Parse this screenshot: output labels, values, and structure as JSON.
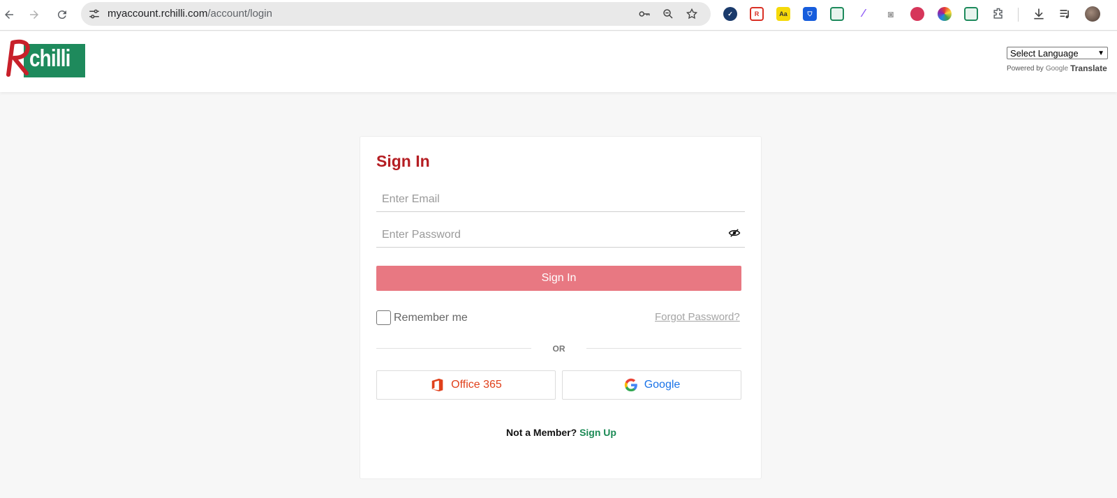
{
  "browser": {
    "url_host": "myaccount.rchilli.com",
    "url_path": "/account/login",
    "extensions": [
      {
        "icon": "check-circle-icon",
        "color": "#1a3a6b"
      },
      {
        "icon": "r-icon",
        "color": "#d93025"
      },
      {
        "icon": "dictionary-icon",
        "color": "#f5d90a",
        "text": "Aa"
      },
      {
        "icon": "bitwarden-icon",
        "color": "#175ddc"
      },
      {
        "icon": "screenshot-icon",
        "color": "#1e8a5c"
      },
      {
        "icon": "pen-icon",
        "color": "#8f5cf5"
      },
      {
        "icon": "camera-icon",
        "color": "#9e9e9e"
      },
      {
        "icon": "raspberry-icon",
        "color": "#d6365a"
      },
      {
        "icon": "color-picker-icon",
        "color": "#6a3de8"
      },
      {
        "icon": "table-capture-icon",
        "color": "#1e8a5c"
      },
      {
        "icon": "puzzle-icon",
        "color": "#5f6368"
      }
    ]
  },
  "header": {
    "logo_text": "chilli",
    "logo_r": "R",
    "language_select": "Select Language",
    "powered_by": "Powered by",
    "google_word": "Google",
    "translate": "Translate"
  },
  "signin": {
    "title": "Sign In",
    "email_placeholder": "Enter Email",
    "email_value": "",
    "password_placeholder": "Enter Password",
    "password_value": "",
    "button": "Sign In",
    "remember": "Remember me",
    "remember_checked": false,
    "forgot": "Forgot Password?",
    "or": "OR",
    "office_label": "Office 365",
    "google_label": "Google",
    "not_member": "Not a Member?",
    "signup": "Sign Up"
  },
  "colors": {
    "brand_red": "#b51e23",
    "button_pink": "#e87882",
    "brand_green": "#1e8a5c",
    "office_orange": "#e0401b",
    "google_blue": "#1a73e8"
  }
}
